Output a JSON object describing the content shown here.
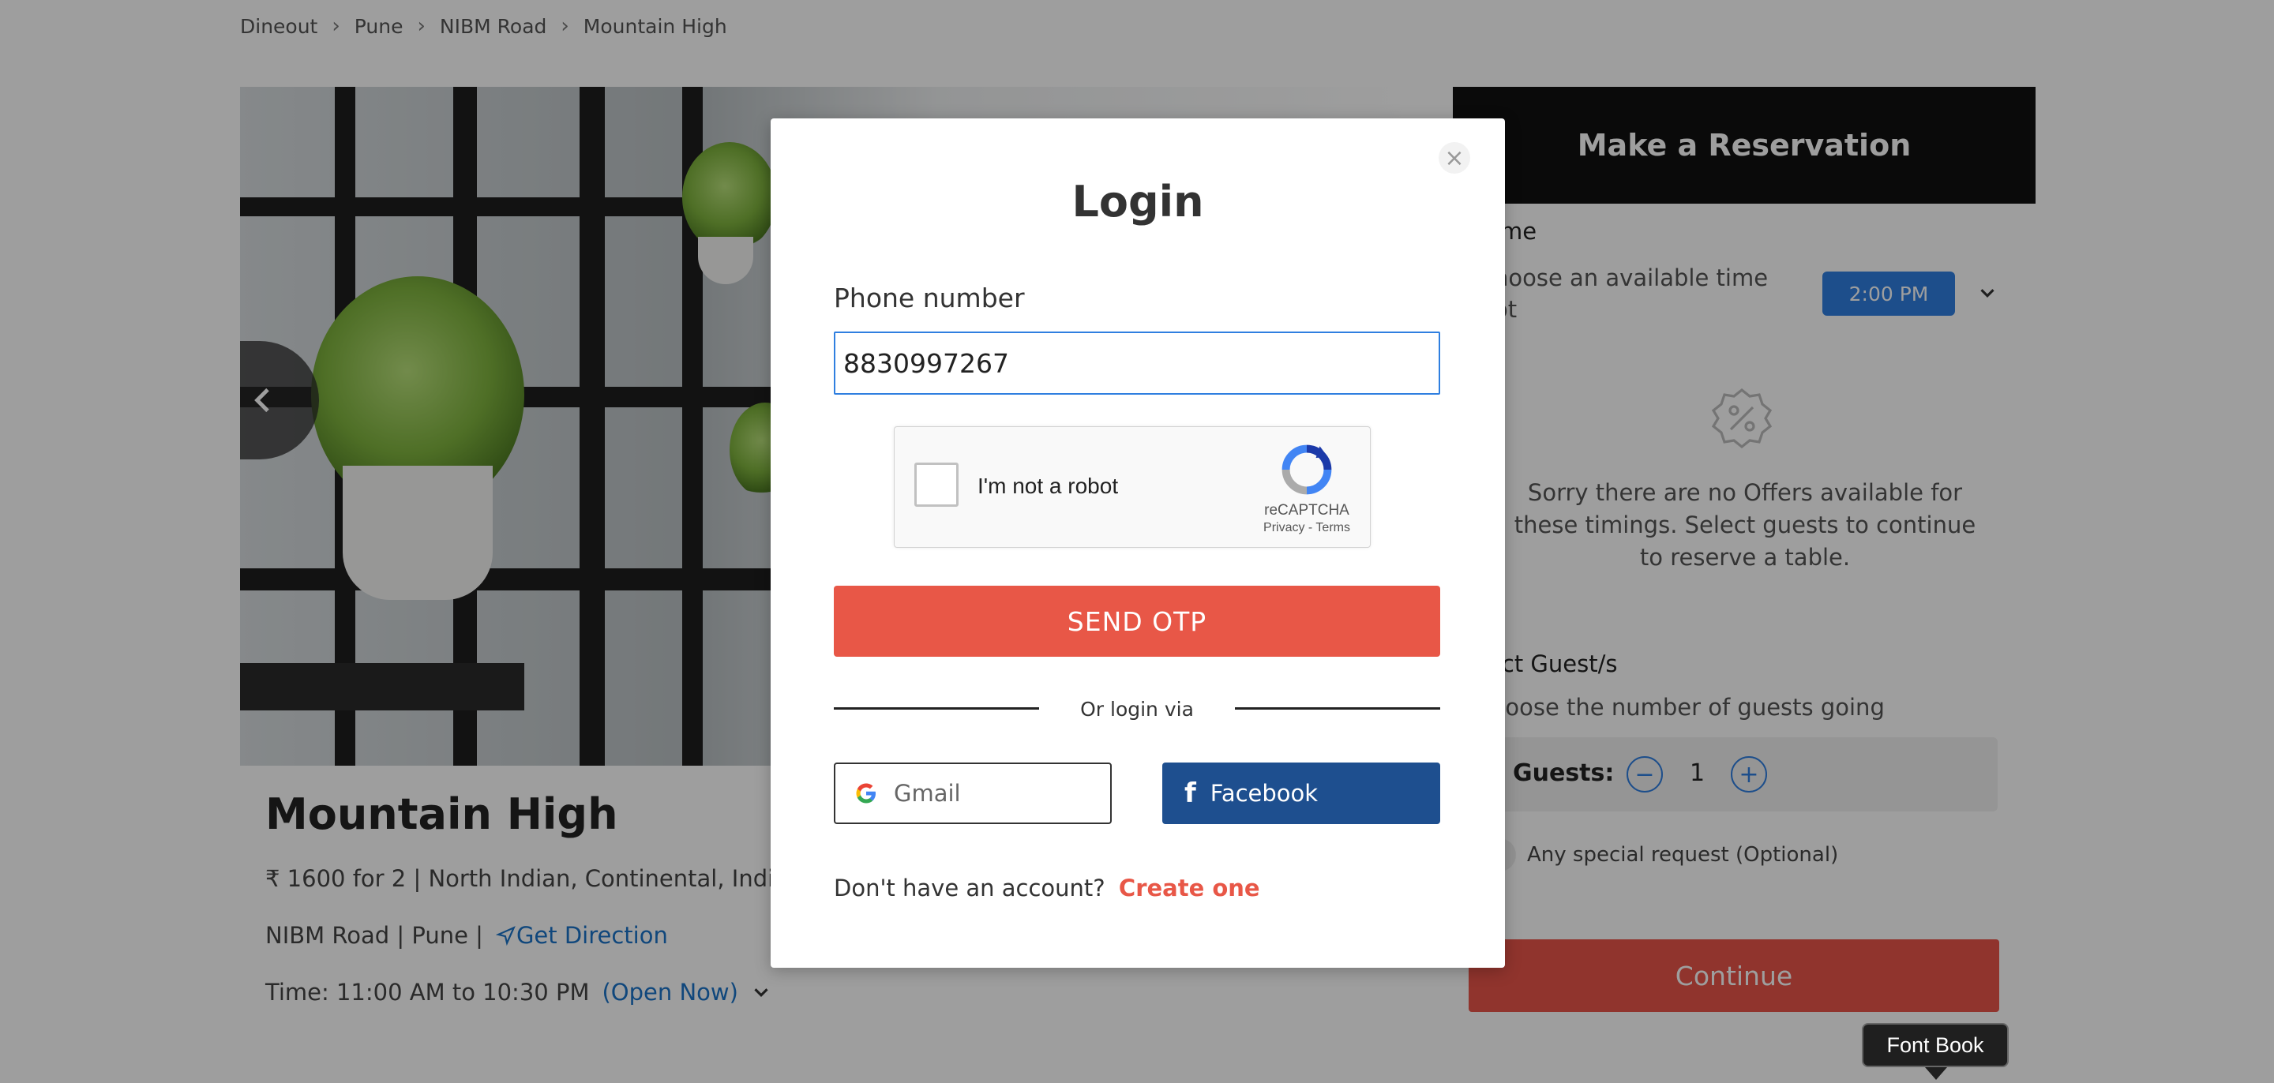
{
  "breadcrumb": [
    "Dineout",
    "Pune",
    "NIBM Road",
    "Mountain High"
  ],
  "restaurant": {
    "name": "Mountain High",
    "meta": "₹ 1600 for 2 | North Indian, Continental, Indian",
    "location": "NIBM Road | Pune |",
    "direction_label": "Get Direction",
    "time": "Time: 11:00 AM to 10:30 PM",
    "open_status": "(Open Now)"
  },
  "reservation": {
    "title": "Make a Reservation",
    "time_label": "me",
    "time_sub_line1": "hoose an available time",
    "time_sub_line2": "ot",
    "selected_time": "2:00 PM",
    "offer_message": "Sorry there are no Offers available for these timings. Select guests to continue to reserve a table.",
    "guests_label": "lect Guest/s",
    "guests_sub": "hoose the number of guests going",
    "guests_field_label": "Guests:",
    "guests_count": "1",
    "minus": "−",
    "plus": "+",
    "special_request": "Any special request (Optional)",
    "continue_label": "Continue"
  },
  "login_modal": {
    "close": "×",
    "title": "Login",
    "phone_label": "Phone number",
    "phone_value": "8830997267",
    "captcha_label": "I'm not a robot",
    "captcha_brand": "reCAPTCHA",
    "captcha_links": "Privacy - Terms",
    "send_otp_label": "SEND OTP",
    "divider_text": "Or login via",
    "gmail_label": "Gmail",
    "facebook_icon": "f",
    "facebook_label": "Facebook",
    "signup_prompt": "Don't have an account?",
    "signup_link": "Create one"
  },
  "tooltip": {
    "text": "Font Book"
  },
  "colors": {
    "accent_red": "#e85747",
    "facebook_blue": "#1e4f8f",
    "link_blue": "#1a73c8",
    "time_pill_blue": "#2f7fe0"
  },
  "icons": [
    "chevron-right-icon",
    "chevron-left-icon",
    "direction-arrow-icon",
    "chevron-down-icon",
    "offer-percent-icon",
    "recaptcha-logo-icon",
    "google-icon",
    "facebook-icon"
  ]
}
